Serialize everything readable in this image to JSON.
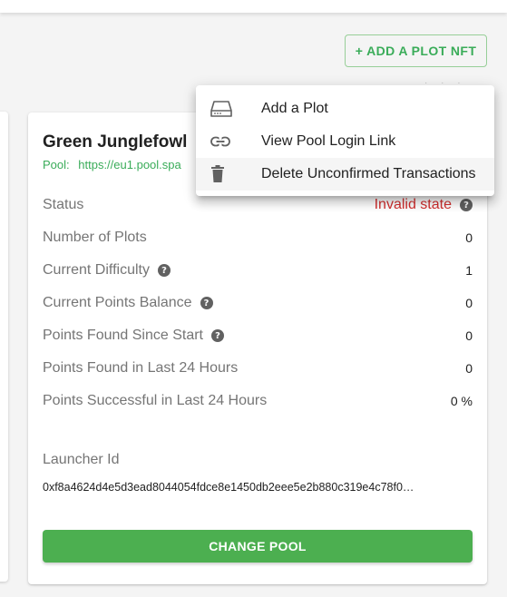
{
  "header": {
    "add_plot_nft_label": "+ ADD A PLOT NFT"
  },
  "card": {
    "title": "Green Junglefowl",
    "pool_label": "Pool:",
    "pool_url": "https://eu1.pool.spa",
    "rows": [
      {
        "label": "Status",
        "value": "Invalid state",
        "help_value": true
      },
      {
        "label": "Number of Plots",
        "value": "0"
      },
      {
        "label": "Current Difficulty",
        "value": "1",
        "help_label": true
      },
      {
        "label": "Current Points Balance",
        "value": "0",
        "help_label": true
      },
      {
        "label": "Points Found Since Start",
        "value": "0",
        "help_label": true
      },
      {
        "label": "Points Found in Last 24 Hours",
        "value": "0"
      },
      {
        "label": "Points Successful in Last 24 Hours",
        "value": "0 %"
      }
    ],
    "launcher_label": "Launcher Id",
    "launcher_value": "0xf8a4624d4e5d3ead8044054fdce8e1450db2eee5e2b880c319e4c78f0…",
    "change_pool_label": "CHANGE POOL"
  },
  "menu": {
    "items": [
      {
        "label": "Add a Plot",
        "icon": "hard-drive-icon"
      },
      {
        "label": "View Pool Login Link",
        "icon": "link-icon"
      },
      {
        "label": "Delete Unconfirmed Transactions",
        "icon": "trash-icon"
      }
    ]
  },
  "colors": {
    "accent_green": "#3aac59",
    "button_green": "#4caf50",
    "error_red": "#d32f2f"
  }
}
